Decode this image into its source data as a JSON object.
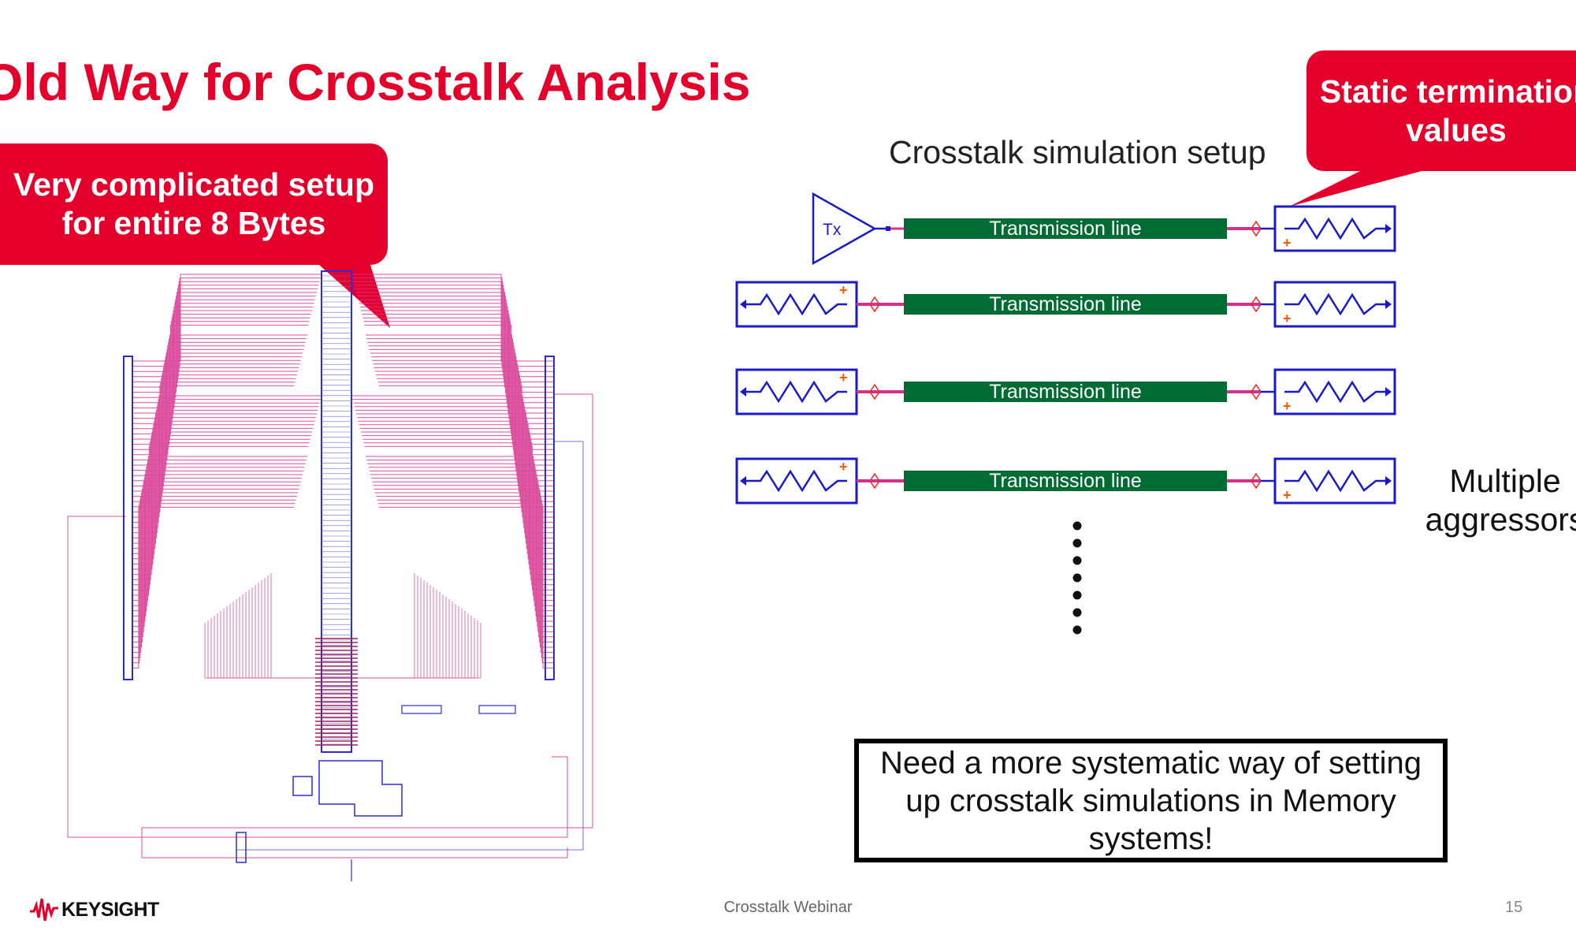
{
  "slide": {
    "title": "Old Way for Crosstalk Analysis",
    "callout_left": [
      "Very complicated setup",
      "for entire 8 Bytes"
    ],
    "callout_right": [
      "Static termination",
      "values"
    ],
    "setup_title": "Crosstalk simulation setup",
    "tx_label": "Tx",
    "transmission_lines": [
      "Transmission line",
      "Transmission line",
      "Transmission line",
      "Transmission line"
    ],
    "aggressors_label": [
      "Multiple",
      "aggressors"
    ],
    "message": "Need a more systematic way of setting up crosstalk simulations in Memory systems!"
  },
  "footer": {
    "logo": "KEYSIGHT",
    "center": "Crosstalk Webinar",
    "page_number": "15"
  },
  "colors": {
    "accent_red": "#e4002b",
    "line_green": "#006b33",
    "schematic_blue": "#1a1acc",
    "schematic_pink": "#d6308e"
  }
}
